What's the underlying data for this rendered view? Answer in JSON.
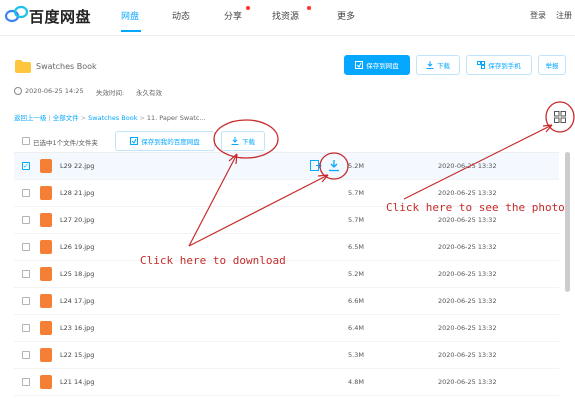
{
  "header": {
    "brand": "百度网盘",
    "nav": [
      "网盘",
      "动态",
      "分享",
      "找资源",
      "更多"
    ],
    "right": [
      "登录",
      "注册"
    ]
  },
  "folder": {
    "name": "Swatches Book",
    "created": "2020-06-25 14:25",
    "expiry_label": "失效时间:",
    "expiry": "永久有效"
  },
  "actions": {
    "save": "保存到网盘",
    "download": "下载",
    "save_phone": "保存到手机",
    "report": "举报"
  },
  "breadcrumb": {
    "back": "返回上一级",
    "all": "全部文件",
    "folder": "Swatches Book",
    "current": "11. Paper Swatc..."
  },
  "selection": {
    "text": "已选中1个文件/文件夹",
    "save": "保存到我的百度网盘",
    "download": "下载"
  },
  "files": [
    {
      "name": "L29 22.jpg",
      "size": "5.2M",
      "date": "2020-06-25 13:32",
      "selected": true
    },
    {
      "name": "L28 21.jpg",
      "size": "5.7M",
      "date": "2020-06-25 13:32"
    },
    {
      "name": "L27 20.jpg",
      "size": "5.7M",
      "date": "2020-06-25 13:32"
    },
    {
      "name": "L26 19.jpg",
      "size": "6.5M",
      "date": "2020-06-25 13:32"
    },
    {
      "name": "L25 18.jpg",
      "size": "5.2M",
      "date": "2020-06-25 13:32"
    },
    {
      "name": "L24 17.jpg",
      "size": "6.6M",
      "date": "2020-06-25 13:32"
    },
    {
      "name": "L23 16.jpg",
      "size": "6.4M",
      "date": "2020-06-25 13:32"
    },
    {
      "name": "L22 15.jpg",
      "size": "5.3M",
      "date": "2020-06-25 13:32"
    },
    {
      "name": "L21 14.jpg",
      "size": "4.8M",
      "date": "2020-06-25 13:32"
    }
  ],
  "annotations": {
    "download": "Click here to download",
    "photo": "Click here to see the photo"
  },
  "colors": {
    "accent": "#06a7ff",
    "annotation": "#c72b2b",
    "image_file": "#f57f34"
  }
}
